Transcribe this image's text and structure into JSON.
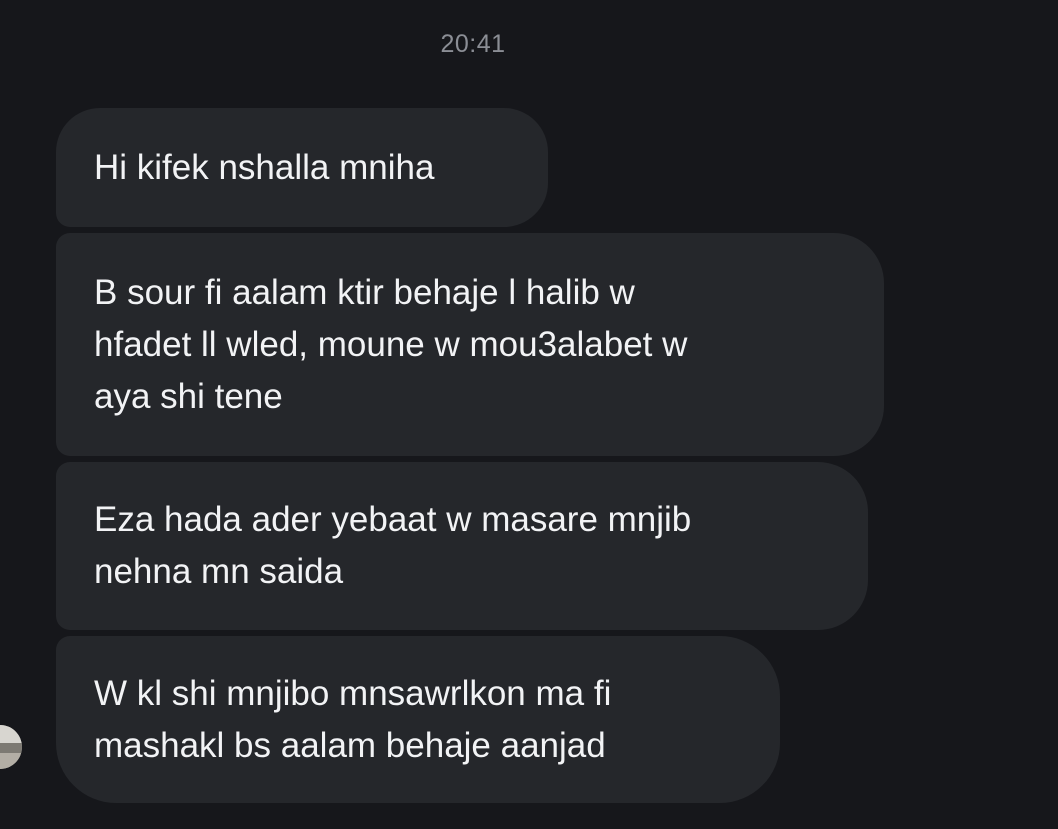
{
  "chat": {
    "timestamp": "20:41",
    "messages": [
      {
        "text": "Hi kifek nshalla mniha"
      },
      {
        "text": "B sour fi aalam ktir behaje l halib w\nhfadet ll wled, moune w mou3alabet w\naya shi tene"
      },
      {
        "text": "Eza hada ader yebaat w masare mnjib\nnehna mn saida"
      },
      {
        "text": "W kl shi mnjibo mnsawrlkon ma fi\nmashakl bs aalam behaje aanjad"
      }
    ],
    "sender_avatar": {
      "icon": "avatar-photo-icon"
    }
  },
  "colors": {
    "background": "#16171b",
    "bubble": "#25272b",
    "text": "#f2f3f5",
    "timestamp": "#8b8e95"
  }
}
